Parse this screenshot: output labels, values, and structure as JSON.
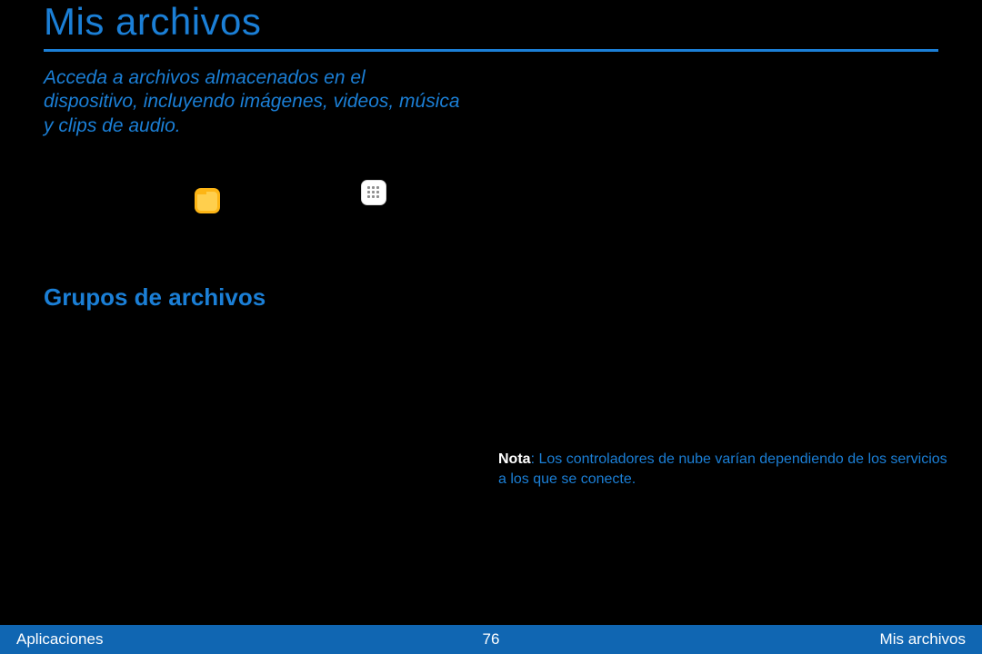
{
  "title": "Mis archivos",
  "intro": "Acceda a archivos almacenados en el dispositivo, incluyendo imágenes, videos, música y clips de audio.",
  "section_title": "Grupos de archivos",
  "note": {
    "label": "Nota",
    "text": ": Los controladores de nube varían dependiendo de los servicios a los que se conecte."
  },
  "footer": {
    "left": "Aplicaciones",
    "center": "76",
    "right": "Mis archivos"
  }
}
